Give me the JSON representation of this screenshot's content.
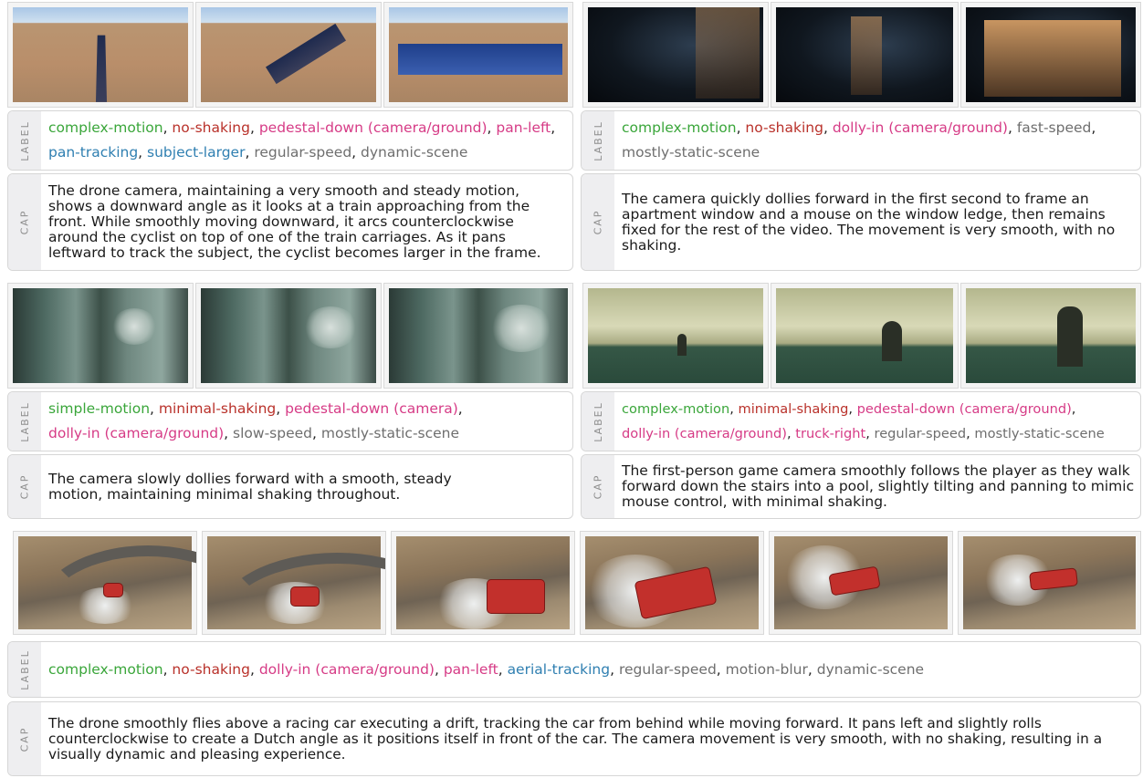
{
  "tabs": {
    "label": "LABEL",
    "cap": "CAP"
  },
  "colors": {
    "motion": "#3aa63a",
    "shaking": "#b9312a",
    "camera": "#d63b86",
    "tracking": "#2f7fb1",
    "other": "#6e6e6e",
    "tab_bg": "#eeeef0",
    "tab_text": "#8d8d8d"
  },
  "panels": [
    {
      "frames": [
        "train-field-frame-1",
        "train-field-frame-2",
        "train-field-frame-3"
      ],
      "label": [
        {
          "text": "complex-motion",
          "type": "motion"
        },
        {
          "text": "no-shaking",
          "type": "shaking"
        },
        {
          "text": "pedestal-down (camera/ground)",
          "type": "camera"
        },
        {
          "text": "pan-left",
          "type": "camera"
        },
        {
          "text": "pan-tracking",
          "type": "tracking"
        },
        {
          "text": "subject-larger",
          "type": "tracking"
        },
        {
          "text": "regular-speed",
          "type": "other"
        },
        {
          "text": "dynamic-scene",
          "type": "other"
        }
      ],
      "caption": "The drone camera, maintaining a very smooth and steady motion, shows a downward angle as it looks at a train approaching from the front. While smoothly moving downward, it arcs counterclockwise around the cyclist on top of one of the train carriages. As it pans leftward to track the subject, the cyclist becomes larger in the frame."
    },
    {
      "frames": [
        "city-night-frame-1",
        "city-night-frame-2",
        "window-mouse-frame-3"
      ],
      "label": [
        {
          "text": "complex-motion",
          "type": "motion"
        },
        {
          "text": "no-shaking",
          "type": "shaking"
        },
        {
          "text": "dolly-in (camera/ground)",
          "type": "camera"
        },
        {
          "text": "fast-speed",
          "type": "other"
        },
        {
          "text": "mostly-static-scene",
          "type": "other"
        }
      ],
      "caption": "The camera quickly dollies forward in the first second to frame an apartment window and a mouse on the window ledge, then remains fixed for the rest of the video. The movement is very smooth, with no shaking."
    },
    {
      "frames": [
        "alley-frame-1",
        "alley-frame-2",
        "alley-frame-3"
      ],
      "label": [
        {
          "text": "simple-motion",
          "type": "motion"
        },
        {
          "text": "minimal-shaking",
          "type": "shaking"
        },
        {
          "text": "pedestal-down (camera)",
          "type": "camera"
        },
        {
          "text": "dolly-in (camera/ground)",
          "type": "camera"
        },
        {
          "text": "slow-speed",
          "type": "other"
        },
        {
          "text": "mostly-static-scene",
          "type": "other"
        }
      ],
      "caption": "The camera slowly dollies forward with a smooth, steady motion, maintaining minimal shaking throughout."
    },
    {
      "frames": [
        "pool-room-frame-1",
        "pool-room-frame-2",
        "pool-room-frame-3"
      ],
      "label": [
        {
          "text": "complex-motion",
          "type": "motion"
        },
        {
          "text": "minimal-shaking",
          "type": "shaking"
        },
        {
          "text": "pedestal-down (camera/ground)",
          "type": "camera"
        },
        {
          "text": "dolly-in (camera/ground)",
          "type": "camera"
        },
        {
          "text": "truck-right",
          "type": "camera"
        },
        {
          "text": "regular-speed",
          "type": "other"
        },
        {
          "text": "mostly-static-scene",
          "type": "other"
        }
      ],
      "caption": "The first-person game camera smoothly follows the player as they walk forward down the stairs into a pool, slightly tilting and panning to mimic mouse control, with minimal shaking."
    },
    {
      "frames": [
        "drift-car-frame-1",
        "drift-car-frame-2",
        "drift-car-frame-3",
        "drift-car-frame-4",
        "drift-car-frame-5",
        "drift-car-frame-6"
      ],
      "label": [
        {
          "text": "complex-motion",
          "type": "motion"
        },
        {
          "text": "no-shaking",
          "type": "shaking"
        },
        {
          "text": "dolly-in (camera/ground)",
          "type": "camera"
        },
        {
          "text": "pan-left",
          "type": "camera"
        },
        {
          "text": "aerial-tracking",
          "type": "tracking"
        },
        {
          "text": "regular-speed",
          "type": "other"
        },
        {
          "text": "motion-blur",
          "type": "other"
        },
        {
          "text": "dynamic-scene",
          "type": "other"
        }
      ],
      "caption": "The drone smoothly flies above a racing car executing a drift, tracking the car from behind while moving forward. It pans left and slightly rolls counterclockwise to create a Dutch angle as it positions itself in front of the car. The camera movement is very smooth, with no shaking, resulting in a visually dynamic and pleasing experience."
    }
  ]
}
